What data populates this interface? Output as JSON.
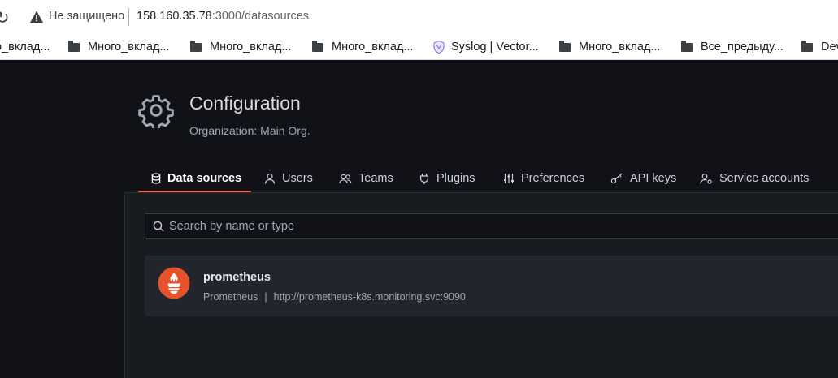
{
  "browser": {
    "security_label": "Не защищено",
    "url_host": "158.160.35.78",
    "url_rest": ":3000/datasources"
  },
  "bookmarks": [
    {
      "label": "о_вклад...",
      "icon": "folder-icon"
    },
    {
      "label": "Много_вклад...",
      "icon": "folder-icon"
    },
    {
      "label": "Много_вклад...",
      "icon": "folder-icon"
    },
    {
      "label": "Много_вклад...",
      "icon": "folder-icon"
    },
    {
      "label": "Syslog | Vector...",
      "icon": "vector-icon"
    },
    {
      "label": "Много_вклад...",
      "icon": "folder-icon"
    },
    {
      "label": "Все_предыду...",
      "icon": "folder-icon"
    },
    {
      "label": "Dev",
      "icon": "folder-icon"
    }
  ],
  "header": {
    "title": "Configuration",
    "subtitle": "Organization: Main Org.",
    "icon": "gear-icon"
  },
  "tabs": [
    {
      "label": "Data sources",
      "icon": "database-icon",
      "active": true
    },
    {
      "label": "Users",
      "icon": "user-icon"
    },
    {
      "label": "Teams",
      "icon": "users-icon"
    },
    {
      "label": "Plugins",
      "icon": "plug-icon"
    },
    {
      "label": "Preferences",
      "icon": "sliders-icon"
    },
    {
      "label": "API keys",
      "icon": "key-icon"
    },
    {
      "label": "Service accounts",
      "icon": "user-cog-icon"
    }
  ],
  "search": {
    "placeholder": "Search by name or type",
    "value": ""
  },
  "datasources": [
    {
      "name": "prometheus",
      "type": "Prometheus",
      "separator": "|",
      "url": "http://prometheus-k8s.monitoring.svc:9090"
    }
  ],
  "colors": {
    "accent": "#f55f3e",
    "background": "#111217",
    "panel": "#181b1f",
    "card": "#22252b",
    "prometheus_brand": "#e6522c"
  }
}
